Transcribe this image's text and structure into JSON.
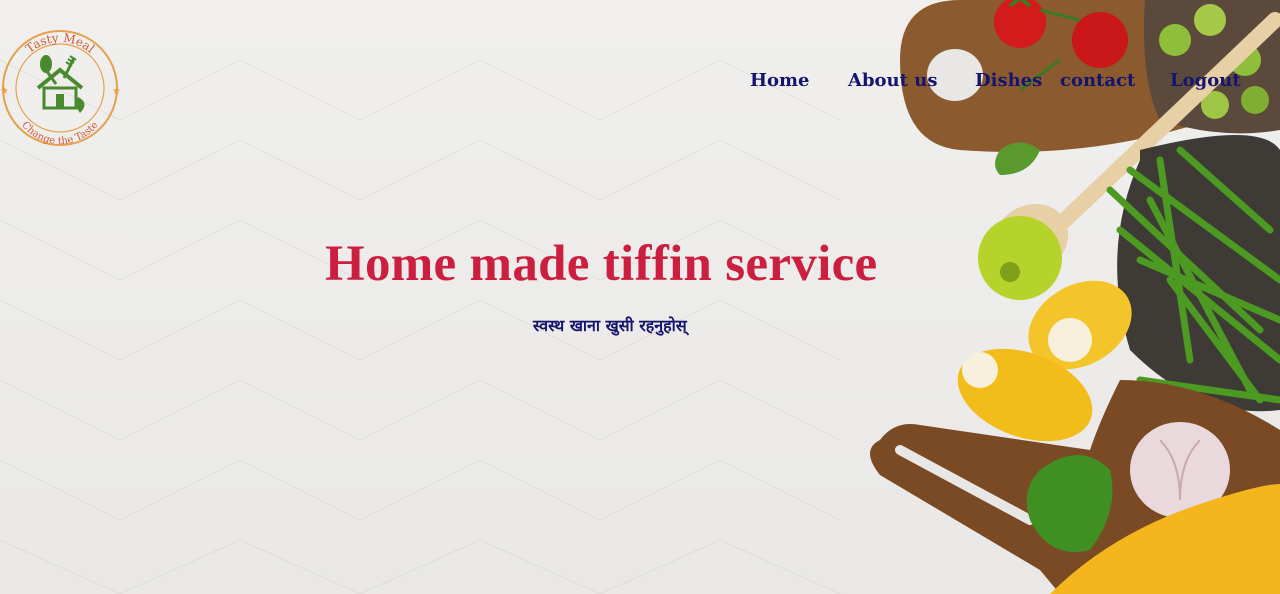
{
  "logo": {
    "top_text": "Tasty Meal",
    "bottom_text": "Change the Taste",
    "icon": "house-fork-spoon-icon"
  },
  "nav": {
    "items": [
      {
        "label": "Home"
      },
      {
        "label": "About us"
      },
      {
        "label": "Dishes"
      },
      {
        "label": "contact"
      },
      {
        "label": "Logout"
      }
    ]
  },
  "hero": {
    "title": "Home made tiffin service",
    "subtitle": "स्वस्थ खाना खुसी रहनुहोस्"
  },
  "colors": {
    "title": "#cc1f3f",
    "nav": "#15156e",
    "background": "#e8e7e5"
  }
}
